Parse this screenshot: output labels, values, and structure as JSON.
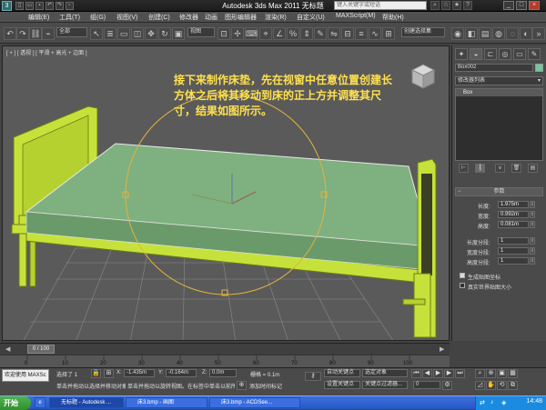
{
  "window": {
    "title": "Autodesk 3ds Max  2011      无标题",
    "search_placeholder": "键入关键字或短语",
    "app_icon": "3ds-max-logo-icon"
  },
  "menu": [
    "编辑(E)",
    "工具(T)",
    "组(G)",
    "视图(V)",
    "创建(C)",
    "修改器",
    "动画",
    "图形编辑器",
    "渲染(R)",
    "自定义(U)",
    "MAXScript(M)",
    "帮助(H)"
  ],
  "toolbar": {
    "selection_filter": "全部",
    "reference_coord": "视图",
    "named_selection": "创建选择集"
  },
  "viewport": {
    "label": "[ + ] [ 透视 ] [ 平滑 + 高光 + 边面 ]",
    "caption": "接下来制作床垫，先在视窗中任意位置创建长方体之后将其移动到床的正上方并调整其尺寸，结果如图所示。",
    "colors": {
      "bed_frame": "#c6e23a",
      "mattress": "#7fb07f",
      "selection_circle": "#e0b340",
      "grid": "#8a8a8a"
    }
  },
  "panel": {
    "object_name": "Box002",
    "object_color": "#72c8a0",
    "modifier_list": "修改器列表",
    "stack_item": "Box",
    "rollout_title": "参数",
    "params": [
      {
        "label": "长度:",
        "value": "1.975m"
      },
      {
        "label": "宽度:",
        "value": "0.992m"
      },
      {
        "label": "高度:",
        "value": "0.081m"
      }
    ],
    "segments": [
      {
        "label": "长度分段:",
        "value": "1"
      },
      {
        "label": "宽度分段:",
        "value": "1"
      },
      {
        "label": "高度分段:",
        "value": "1"
      }
    ],
    "gen_mapping": "生成贴图坐标",
    "real_world": "真实世界贴图大小"
  },
  "timeline": {
    "frame": "0 / 100",
    "ticks": [
      "0",
      "10",
      "20",
      "30",
      "40",
      "50",
      "60",
      "70",
      "80",
      "90",
      "100"
    ]
  },
  "status": {
    "selected": "选择了 1",
    "x_label": "X:",
    "x_value": "-1.435m",
    "y_label": "Y:",
    "y_value": "-0.164m",
    "z_label": "Z:",
    "z_value": "0.0m",
    "grid": "栅格 = 0.1m",
    "auto_key": "自动关键点",
    "set_key": "设置关键点",
    "key_filters": "关键点过滤器...",
    "selection_set": "选定对象",
    "frame_spinner": "0",
    "welcome": "欢迎使用  MAXSc",
    "prompt1": "单击并拖动以选择并移动对象",
    "prompt2": "单击并拖动以旋转视图。在标签中单击以前所捕获",
    "add_time_tag": "添加时间标记"
  },
  "taskbar": {
    "start": "开始",
    "tasks": [
      "无标题 - Autodesk ...",
      "床3.bmp - 画图",
      "床3.bmp - ACDSee..."
    ],
    "clock": "14:48"
  }
}
